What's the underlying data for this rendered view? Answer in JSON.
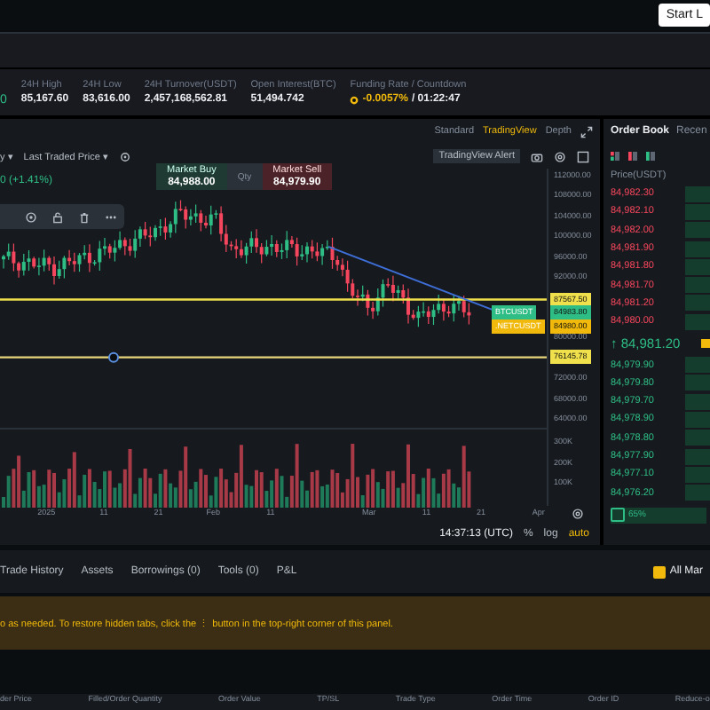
{
  "top_bar": {
    "button": "Start L"
  },
  "stats": {
    "lead": "0",
    "items": [
      {
        "label": "24H High",
        "value": "85,167.60",
        "kind": "plain"
      },
      {
        "label": "24H Low",
        "value": "83,616.00",
        "kind": "plain"
      },
      {
        "label": "24H Turnover(USDT)",
        "value": "2,457,168,562.81",
        "kind": "plain"
      },
      {
        "label": "Open Interest(BTC)",
        "value": "51,494.742",
        "kind": "plain"
      },
      {
        "label": "Funding Rate / Countdown",
        "value": "-0.0057%",
        "extra": "/ 01:22:47",
        "kind": "funding"
      }
    ]
  },
  "chart": {
    "view_tabs": [
      {
        "label": "Standard",
        "selected": false
      },
      {
        "label": "TradingView",
        "selected": true
      },
      {
        "label": "Depth",
        "selected": false
      }
    ],
    "interval": "y ▾",
    "price_type": "Last Traded Price ▾",
    "alert": "TradingView Alert",
    "change": "0 (+1.41%)",
    "market_buy": {
      "label": "Market Buy",
      "price": "84,988.00"
    },
    "qty": "Qty",
    "market_sell": {
      "label": "Market Sell",
      "price": "84,979.90"
    },
    "price_axis": [
      "112000.00",
      "108000.00",
      "104000.00",
      "100000.00",
      "96000.00",
      "92000.00",
      "80000.00",
      "72000.00",
      "68000.00",
      "64000.00"
    ],
    "price_tags": [
      {
        "label": "87567.50",
        "kind": "line"
      },
      {
        "label": "84983.80",
        "symbol": "BTCUSDT",
        "kind": "symbol",
        "color": "#2ebd85"
      },
      {
        "label": "84980.00",
        "symbol": ".NETCUSDT",
        "kind": "symbol",
        "color": "#f0b90b"
      },
      {
        "label": "76145.78",
        "kind": "line"
      }
    ],
    "volume_axis": [
      "300K",
      "200K",
      "100K"
    ],
    "time_axis": [
      "2025",
      "11",
      "21",
      "Feb",
      "11",
      "Mar",
      "11",
      "21",
      "Apr"
    ],
    "time": "14:37:13 (UTC)",
    "scale_options": [
      {
        "label": "%",
        "selected": false
      },
      {
        "label": "log",
        "selected": false
      },
      {
        "label": "auto",
        "selected": true
      }
    ]
  },
  "order_book": {
    "tabs": [
      {
        "label": "Order Book",
        "selected": true
      },
      {
        "label": "Recen",
        "selected": false
      }
    ],
    "header": "Price(USDT)",
    "asks": [
      "84,982.30",
      "84,982.10",
      "84,982.00",
      "84,981.90",
      "84,981.80",
      "84,981.70",
      "84,981.20",
      "84,980.00"
    ],
    "mid": "↑ 84,981.20",
    "bids": [
      "84,979.90",
      "84,979.80",
      "84,979.70",
      "84,978.90",
      "84,978.80",
      "84,977.90",
      "84,977.10",
      "84,976.20"
    ],
    "ratio": "65%"
  },
  "bottom_tabs": [
    {
      "label": "Trade History",
      "selected": false
    },
    {
      "label": "Assets",
      "selected": false
    },
    {
      "label": "Borrowings (0)",
      "selected": false
    },
    {
      "label": "Tools (0)",
      "selected": false
    },
    {
      "label": "P&L",
      "selected": false
    }
  ],
  "all_markets": {
    "label": "All Mar",
    "checked": true
  },
  "notice": "o as needed. To restore hidden tabs, click the ⋮ button in the top-right corner of this panel.",
  "columns": [
    "der Price",
    "Filled/Order Quantity",
    "Order Value",
    "TP/SL",
    "Trade Type",
    "Order Time",
    "Order ID",
    "Reduce-o"
  ]
}
